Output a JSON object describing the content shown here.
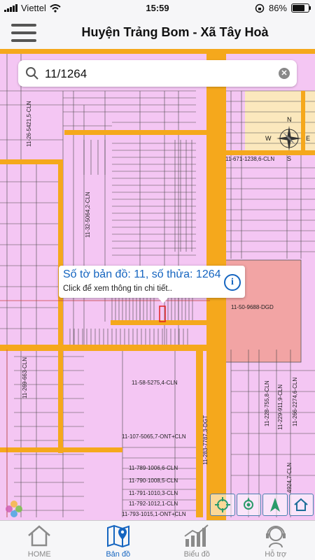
{
  "status_bar": {
    "carrier": "Viettel",
    "time": "15:59",
    "battery": "86%"
  },
  "header": {
    "title": "Huyện Trảng Bom - Xã Tây Hoà"
  },
  "search": {
    "value": "11/1264",
    "placeholder": ""
  },
  "popup": {
    "title": "Số tờ bản đồ: 11, số thửa: 1264",
    "subtitle": "Click để xem thông tin chi tiết.."
  },
  "compass": {
    "n": "N",
    "s": "S",
    "e": "E",
    "w": "W"
  },
  "map_labels": {
    "l1": "11-26-5421,5-CLN",
    "l2": "11-671-1238,6-CLN",
    "l3": "11-32-5064,2-CLN",
    "l4": "11-50-9688-DGD",
    "l5": "11-269-663-CLN",
    "l6": "11-58-5275,4-CLN",
    "l7": "11-107-5065,7-ONT+CLN",
    "l8": "11-283-7787,3-DGT",
    "l9": "11-228-755,8-CLN",
    "l10": "11-229-911,9-CLN",
    "l11": "11-266-2274,6-CLN",
    "l12": "11-789-1006,6-CLN",
    "l13": "11-790-1008,5-CLN",
    "l14": "11-791-1010,3-CLN",
    "l15": "11-792-1012,1-CLN",
    "l16": "11-793-1015,1-ONT+CLN",
    "l17": "4924,7-CLN"
  },
  "tabs": [
    {
      "label": "HOME",
      "icon": "home-icon"
    },
    {
      "label": "Bản đồ",
      "icon": "map-icon"
    },
    {
      "label": "Biểu đồ",
      "icon": "chart-icon"
    },
    {
      "label": "Hỗ trợ",
      "icon": "support-icon"
    }
  ],
  "colors": {
    "road": "#f5a81c",
    "parcel": "#f4c6f3",
    "highlight_parcel": "#f2a4a4",
    "accent": "#1565c0"
  }
}
